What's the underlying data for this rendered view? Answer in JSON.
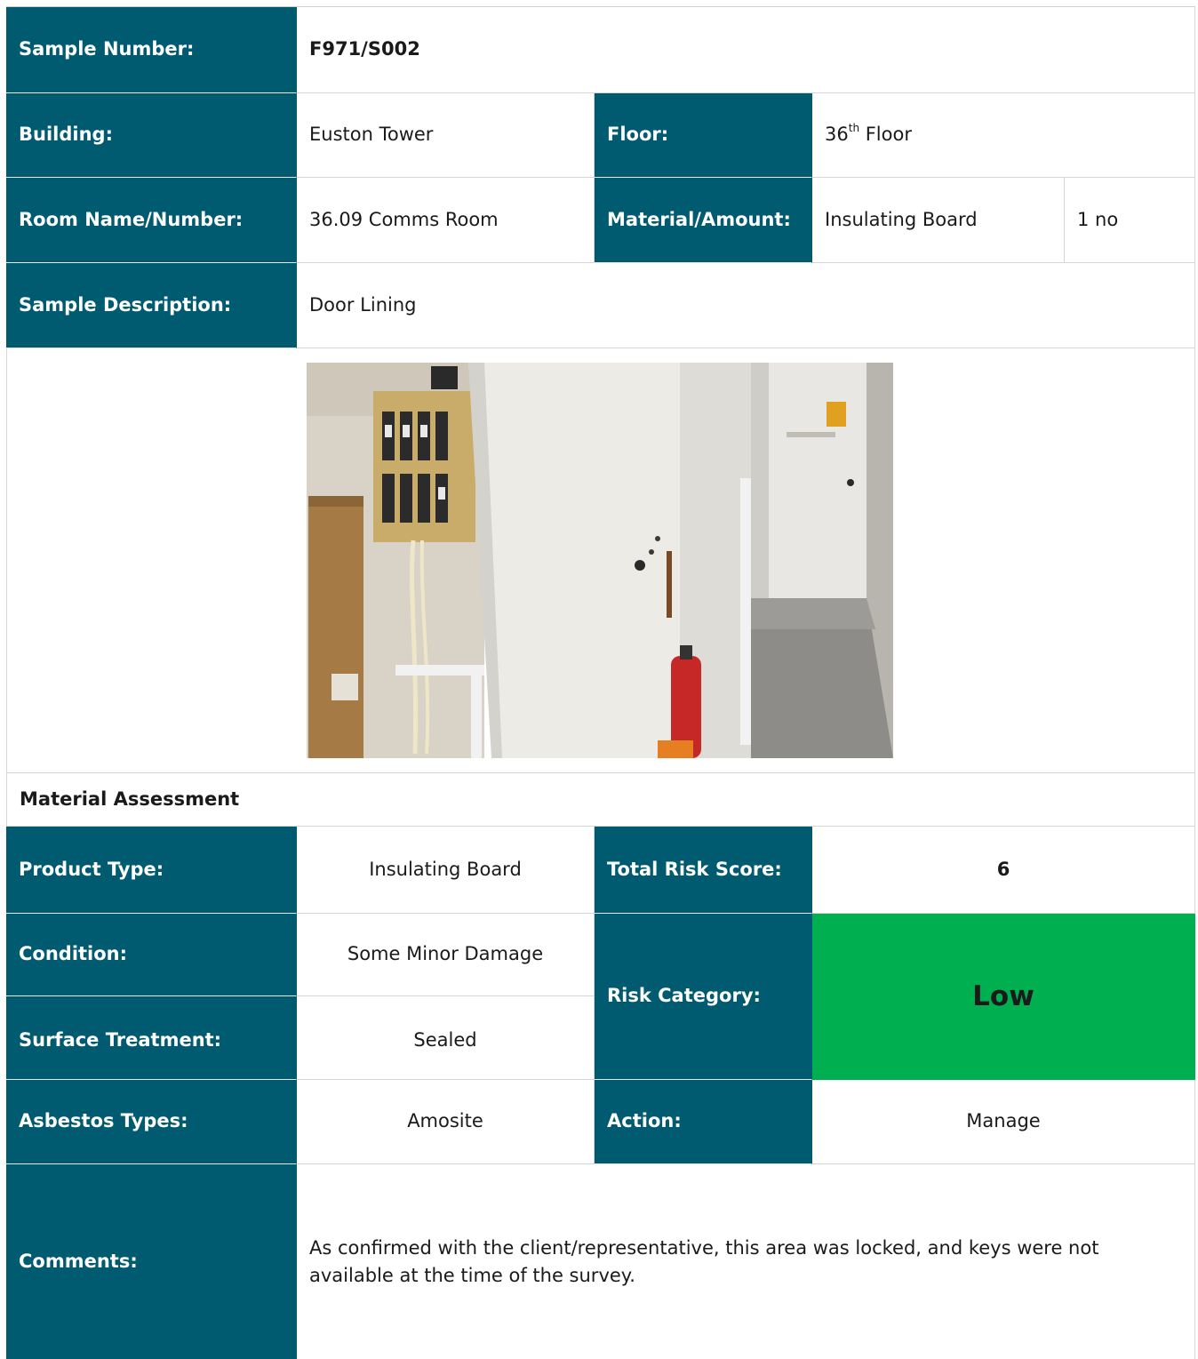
{
  "sample": {
    "sample_number_label": "Sample Number:",
    "sample_number_value": "F971/S002",
    "building_label": "Building:",
    "building_value": "Euston Tower",
    "floor_label": "Floor:",
    "floor_number": "36",
    "floor_suffix": "th",
    "floor_word": " Floor",
    "room_label": "Room Name/Number:",
    "room_value": "36.09 Comms Room",
    "material_label": "Material/Amount:",
    "material_value": "Insulating Board",
    "amount_value": "1 no",
    "description_label": "Sample Description:",
    "description_value": "Door Lining"
  },
  "assessment": {
    "heading": "Material Assessment",
    "product_type_label": "Product Type:",
    "product_type_value": "Insulating Board",
    "total_risk_label": "Total Risk Score:",
    "total_risk_value": "6",
    "condition_label": "Condition:",
    "condition_value": "Some Minor Damage",
    "risk_category_label": "Risk Category:",
    "risk_category_value": "Low",
    "surface_label": "Surface Treatment:",
    "surface_value": "Sealed",
    "asbestos_label": "Asbestos Types:",
    "asbestos_value": "Amosite",
    "action_label": "Action:",
    "action_value": "Manage",
    "comments_label": "Comments:",
    "comments_value": "As confirmed with the client/representative, this area was locked, and keys were not available at the time of the survey."
  },
  "colors": {
    "label_bg": "#005a70",
    "risk_low": "#00b050"
  }
}
